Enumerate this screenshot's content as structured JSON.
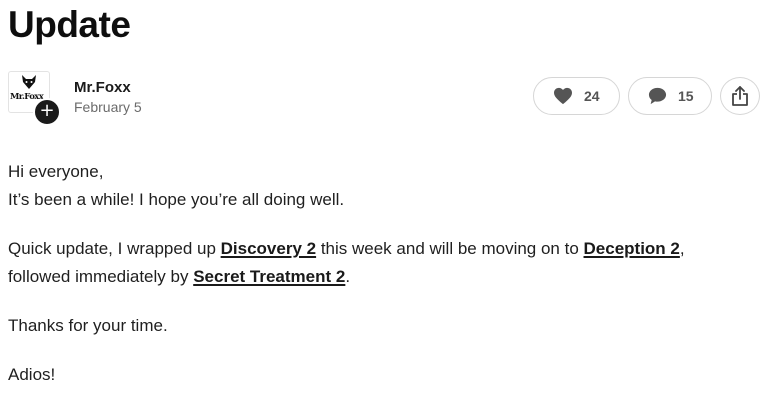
{
  "post": {
    "title": "Update"
  },
  "author": {
    "name": "Mr.Foxx",
    "date": "February 5",
    "avatar_text": "Mr.Foxx",
    "follow_symbol": "+"
  },
  "actions": {
    "likes": "24",
    "comments": "15",
    "icons": [
      "heart-icon",
      "comment-bubble-icon",
      "share-icon"
    ]
  },
  "content": {
    "greeting": "Hi everyone,",
    "intro": "It’s been a while! I hope you’re all doing well.",
    "update_part1": "Quick update, I wrapped up ",
    "link1": "Discovery 2",
    "update_part2": " this week and will be moving on to ",
    "link2": "Deception 2",
    "update_part3": ",",
    "update_part4": "followed immediately by ",
    "link3": "Secret Treatment 2",
    "update_part5": ".",
    "thanks": "Thanks for your time.",
    "signoff": "Adios!"
  }
}
